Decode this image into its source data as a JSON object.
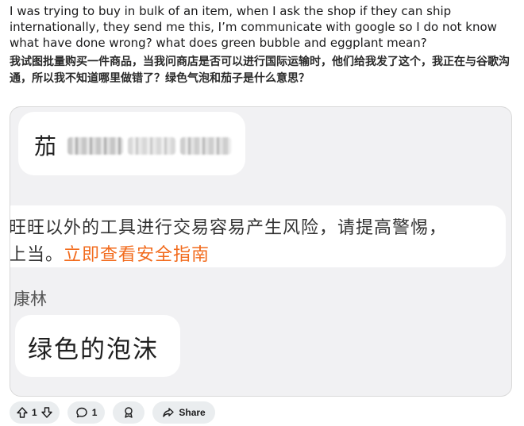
{
  "post": {
    "body_en": "I was trying to buy in bulk of an item, when I ask the shop if they can ship internationally, they send me this, I’m communicate with google so I do not know what have done wrong? what does green bubble and eggplant mean?",
    "body_zh": "我试图批量购买一件商品，当我问商店是否可以进行国际运输时，他们给我发了这个，我正在与谷歌沟通，所以我不知道哪里做错了？绿色气泡和茄子是什么意思？"
  },
  "screenshot": {
    "top_bubble_char": "茄",
    "notice_line1": "旺旺以外的工具进行交易容易产生风险，请提高警惕，",
    "notice_line2_prefix": "上当。",
    "notice_link": "立即查看安全指南",
    "sender_name": "康林",
    "green_bubble_text": "绿色的泡沫"
  },
  "actions": {
    "vote_count": "1",
    "comment_count": "1",
    "share_label": "Share"
  },
  "colors": {
    "link_orange": "#f26b1d",
    "pill_bg": "#eaedef"
  }
}
